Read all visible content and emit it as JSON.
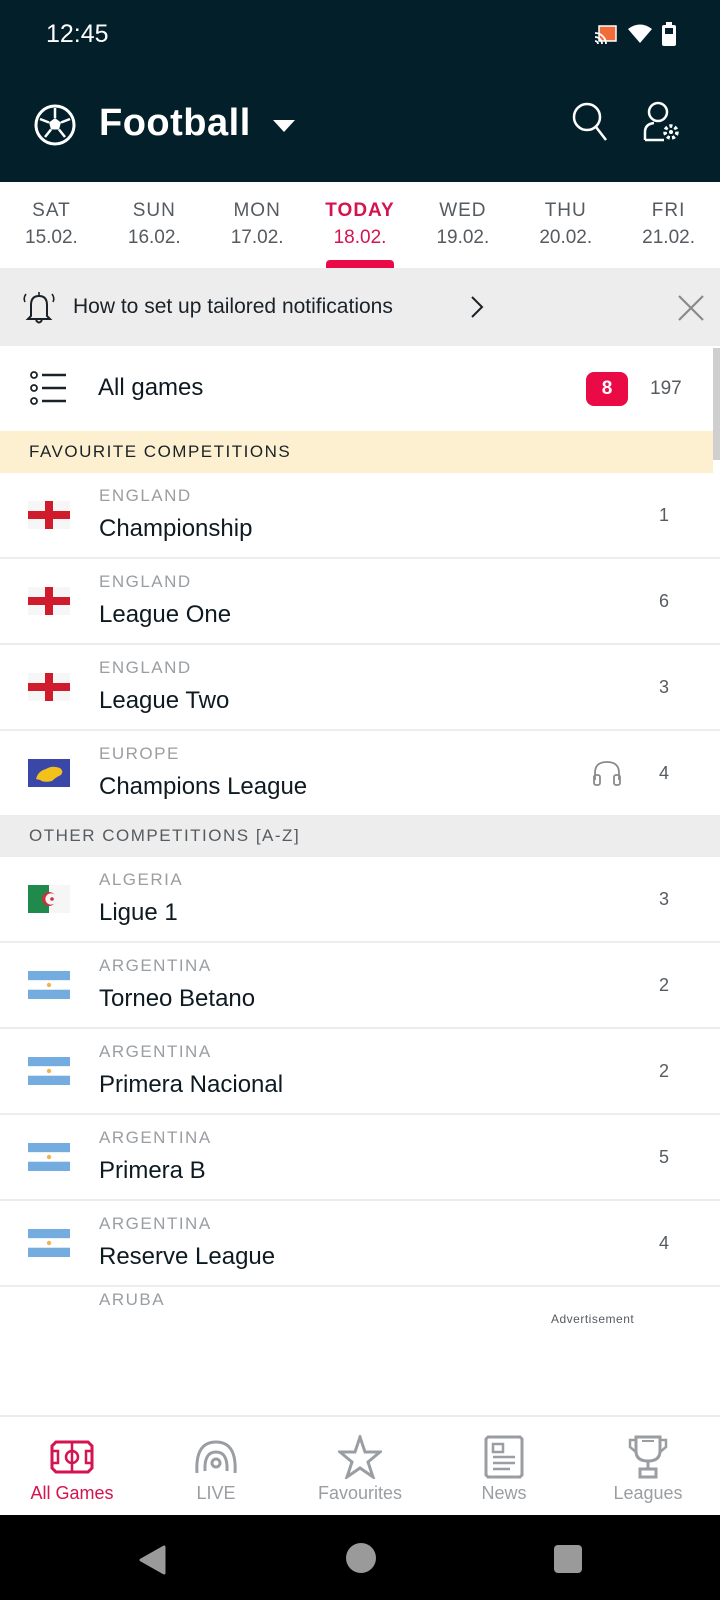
{
  "status_bar": {
    "time": "12:45"
  },
  "app_bar": {
    "sport": "Football"
  },
  "dates": [
    {
      "dow": "SAT",
      "date": "15.02.",
      "active": false
    },
    {
      "dow": "SUN",
      "date": "16.02.",
      "active": false
    },
    {
      "dow": "MON",
      "date": "17.02.",
      "active": false
    },
    {
      "dow": "TODAY",
      "date": "18.02.",
      "active": true
    },
    {
      "dow": "WED",
      "date": "19.02.",
      "active": false
    },
    {
      "dow": "THU",
      "date": "20.02.",
      "active": false
    },
    {
      "dow": "FRI",
      "date": "21.02.",
      "active": false
    }
  ],
  "notification_banner": {
    "text": "How to set up tailored notifications"
  },
  "all_games": {
    "label": "All games",
    "live_count": "8",
    "total_count": "197"
  },
  "sections": {
    "favourites": "FAVOURITE COMPETITIONS",
    "other": "OTHER COMPETITIONS [A-Z]"
  },
  "favourite_competitions": [
    {
      "country": "ENGLAND",
      "name": "Championship",
      "count": "1",
      "flag": "england"
    },
    {
      "country": "ENGLAND",
      "name": "League One",
      "count": "6",
      "flag": "england"
    },
    {
      "country": "ENGLAND",
      "name": "League Two",
      "count": "3",
      "flag": "england"
    },
    {
      "country": "EUROPE",
      "name": "Champions League",
      "count": "4",
      "flag": "europe",
      "audio": true
    }
  ],
  "other_competitions": [
    {
      "country": "ALGERIA",
      "name": "Ligue 1",
      "count": "3",
      "flag": "algeria"
    },
    {
      "country": "ARGENTINA",
      "name": "Torneo Betano",
      "count": "2",
      "flag": "argentina"
    },
    {
      "country": "ARGENTINA",
      "name": "Primera Nacional",
      "count": "2",
      "flag": "argentina"
    },
    {
      "country": "ARGENTINA",
      "name": "Primera B",
      "count": "5",
      "flag": "argentina"
    },
    {
      "country": "ARGENTINA",
      "name": "Reserve League",
      "count": "4",
      "flag": "argentina"
    }
  ],
  "partial_row": {
    "country": "ARUBA"
  },
  "ad_label": "Advertisement",
  "bottom_nav": [
    {
      "label": "All Games",
      "icon": "pitch-icon",
      "active": true
    },
    {
      "label": "LIVE",
      "icon": "live-icon",
      "active": false
    },
    {
      "label": "Favourites",
      "icon": "star-icon",
      "active": false
    },
    {
      "label": "News",
      "icon": "news-icon",
      "active": false
    },
    {
      "label": "Leagues",
      "icon": "trophy-icon",
      "active": false
    }
  ],
  "colors": {
    "accent": "#ea0a46",
    "header_bg": "#03202a",
    "favourite_bg": "#fdf0d0"
  }
}
